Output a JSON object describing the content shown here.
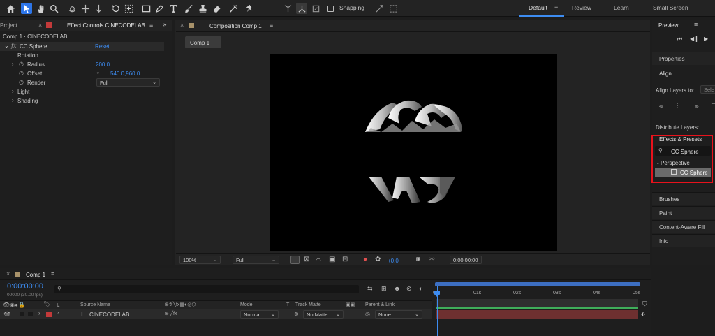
{
  "toolbar": {
    "tools": [
      "home-icon",
      "selection-arrow-icon",
      "hand-icon",
      "zoom-icon",
      "orbit-camera-icon",
      "move-camera-icon",
      "dolly-camera-icon",
      "rotate-icon",
      "anchor-icon",
      "rectangle-icon",
      "pen-icon",
      "type-icon",
      "brush-icon",
      "clone-stamp-icon",
      "eraser-icon",
      "roto-brush-icon",
      "puppet-pin-icon"
    ],
    "snapping_label": "Snapping",
    "workspaces": [
      "Default",
      "Review",
      "Learn",
      "Small Screen"
    ]
  },
  "project_tab": "Project",
  "effect_controls": {
    "tab_label": "Effect Controls CINECODELAB",
    "breadcrumb": "Comp 1 · CINECODELAB",
    "effect_name": "CC Sphere",
    "reset_label": "Reset",
    "props": [
      {
        "label": "Rotation",
        "value": ""
      },
      {
        "label": "Radius",
        "value": "200.0"
      },
      {
        "label": "Offset",
        "value": "540.0,960.0"
      },
      {
        "label": "Render",
        "value": "Full"
      },
      {
        "label": "Light",
        "value": ""
      },
      {
        "label": "Shading",
        "value": ""
      }
    ]
  },
  "composition": {
    "tab_label": "Composition Comp 1",
    "comp_button": "Comp 1",
    "logo_top": "CINECO",
    "logo_bottom": "LAB",
    "bottom_bar": {
      "zoom": "100%",
      "resolution": "Full",
      "exposure": "+0.0",
      "timecode": "0:00:00:00"
    }
  },
  "right_panel": {
    "preview_label": "Preview",
    "properties_label": "Properties",
    "align_label": "Align",
    "align_layers_to_label": "Align Layers to:",
    "align_layers_to_value": "Sele",
    "distribute_label": "Distribute Layers:",
    "effects_presets_label": "Effects & Presets",
    "search_value": "CC Sphere",
    "category": "Perspective",
    "result_item": "CC Sphere",
    "highlight_color": "#e8121c",
    "rows": [
      "Brushes",
      "Paint",
      "Content-Aware Fill",
      "Info"
    ]
  },
  "timeline": {
    "tab_label": "Comp 1",
    "timecode": "0:00:00:00",
    "fps": "00000 (30.00 fps)",
    "columns": {
      "hash": "#",
      "source_name": "Source Name",
      "mode": "Mode",
      "t": "T",
      "track_matte": "Track Matte",
      "parent": "Parent & Link"
    },
    "ruler": [
      "0s",
      "01s",
      "02s",
      "03s",
      "04s",
      "05s"
    ],
    "layer": {
      "index": "1",
      "name": "CINECODELAB",
      "mode": "Normal",
      "matte": "No Matte",
      "parent": "None"
    }
  }
}
